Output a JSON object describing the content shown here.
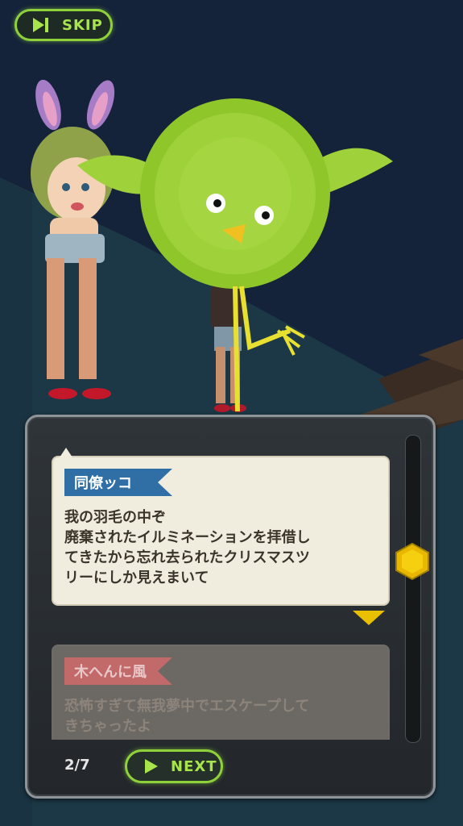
{
  "controls": {
    "skip_label": "SKIP",
    "next_label": "NEXT",
    "page_indicator": "2/7"
  },
  "dialog": {
    "current": {
      "speaker": "同僚ッコ",
      "text": "我の羽毛の中ぞ\n廃棄されたイルミネーションを拝借し\nてきたから忘れ去られたクリスマスツ\nリーにしか見えまいて"
    },
    "next": {
      "speaker": "木へんに風",
      "text": "恐怖すぎて無我夢中でエスケープして\nきちゃったよ"
    }
  },
  "scroll": {
    "position": 0.4
  },
  "colors": {
    "accent": "#8fd13a",
    "panel": "#2a2e33",
    "speaker_tag": "#2f6fa6",
    "speaker_tag_faded": "#c26a6a"
  },
  "icons": {
    "skip": "skip-icon",
    "next": "play-icon",
    "scroll": "hexagon-icon"
  }
}
